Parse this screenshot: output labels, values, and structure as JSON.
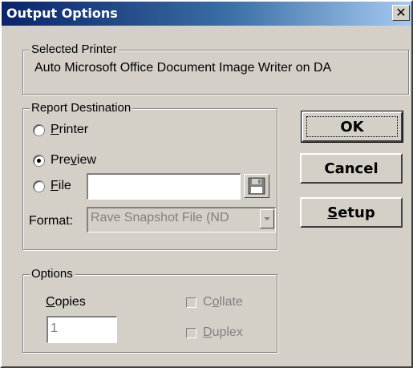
{
  "window": {
    "title": "Output Options",
    "close_glyph": "✕"
  },
  "selected_printer": {
    "legend": "Selected Printer",
    "name": "Auto Microsoft Office Document Image Writer on DA"
  },
  "report_destination": {
    "legend": "Report Destination",
    "options": [
      {
        "prefix": "",
        "accel": "P",
        "rest": "rinter",
        "checked": false
      },
      {
        "prefix": "Pre",
        "accel": "v",
        "rest": "iew",
        "checked": true
      },
      {
        "prefix": "",
        "accel": "F",
        "rest": "ile",
        "checked": false
      }
    ],
    "file_value": "",
    "format_label": "Format:",
    "format_value": "Rave Snapshot File (ND"
  },
  "buttons": {
    "ok": "OK",
    "cancel": "Cancel",
    "setup_accel": "S",
    "setup_rest": "etup"
  },
  "options": {
    "legend": "Options",
    "copies_accel": "C",
    "copies_rest": "opies",
    "copies_value": "1",
    "collate_prefix": "C",
    "collate_accel": "o",
    "collate_rest": "llate",
    "collate_checked": false,
    "duplex_accel": "D",
    "duplex_rest": "uplex",
    "duplex_checked": false
  },
  "icons": {
    "close": "close-icon",
    "save_file": "floppy-disk-icon",
    "dropdown": "chevron-down-icon"
  }
}
